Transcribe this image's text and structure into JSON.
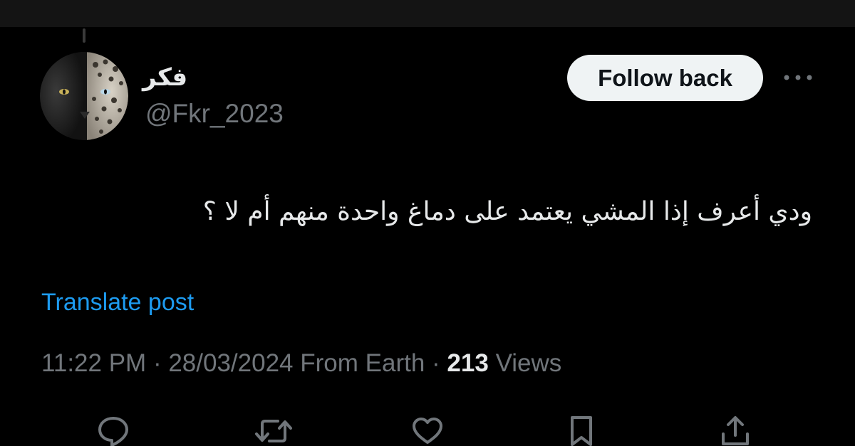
{
  "post": {
    "author": {
      "display_name": "فكر",
      "handle": "@Fkr_2023"
    },
    "follow_label": "Follow back",
    "text": "ودي أعرف إذا المشي يعتمد على دماغ واحدة منهم أم لا ؟",
    "translate_label": "Translate post",
    "meta": {
      "time": "11:22 PM",
      "separator": "·",
      "date": "28/03/2024",
      "location": "From Earth",
      "views_count": "213",
      "views_label": "Views"
    },
    "actions": [
      {
        "icon": "reply-icon"
      },
      {
        "icon": "repost-icon"
      },
      {
        "icon": "like-icon"
      },
      {
        "icon": "bookmark-icon"
      },
      {
        "icon": "share-icon"
      }
    ]
  },
  "colors": {
    "background": "#000000",
    "text_primary": "#e7e9ea",
    "text_secondary": "#71767b",
    "link": "#1d9bf0",
    "button_bg": "#eff3f4"
  }
}
